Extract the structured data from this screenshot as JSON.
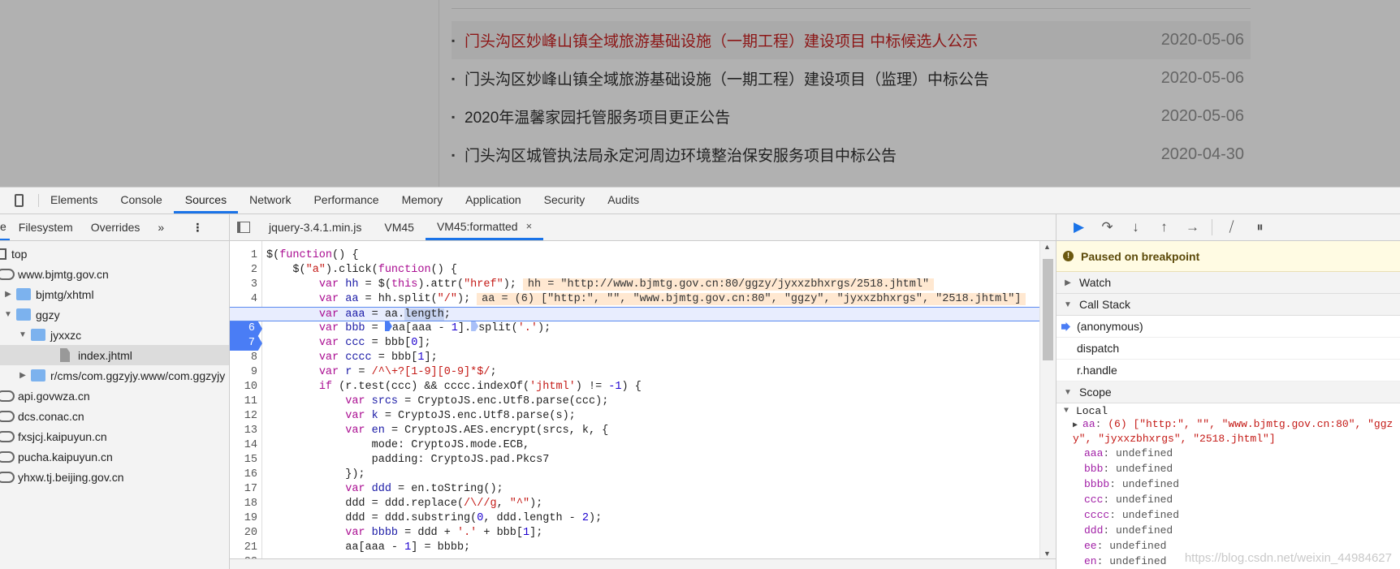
{
  "page": {
    "news": [
      {
        "title": "门头沟区妙峰山镇全域旅游基础设施（一期工程）建设项目 中标候选人公示",
        "date": "2020-05-06",
        "highlighted": true
      },
      {
        "title": "门头沟区妙峰山镇全域旅游基础设施（一期工程）建设项目（监理）中标公告",
        "date": "2020-05-06"
      },
      {
        "title": "2020年温馨家园托管服务项目更正公告",
        "date": "2020-05-06"
      },
      {
        "title": "门头沟区城管执法局永定河周边环境整治保安服务项目中标公告",
        "date": "2020-04-30"
      }
    ],
    "bullet": "▪"
  },
  "devtools": {
    "tabs": [
      "Elements",
      "Console",
      "Sources",
      "Network",
      "Performance",
      "Memory",
      "Application",
      "Security",
      "Audits"
    ],
    "active_tab": "Sources",
    "navigator": {
      "tabs": [
        "e",
        "Filesystem",
        "Overrides"
      ],
      "more": "»",
      "menu": "⋮",
      "tree": [
        {
          "label": "top",
          "type": "frame",
          "depth": 0
        },
        {
          "label": "www.bjmtg.gov.cn",
          "type": "cloud",
          "depth": 0
        },
        {
          "label": "bjmtg/xhtml",
          "type": "folder",
          "depth": 1,
          "state": "collapsed"
        },
        {
          "label": "ggzy",
          "type": "folder",
          "depth": 1,
          "state": "expanded"
        },
        {
          "label": "jyxxzc",
          "type": "folder",
          "depth": 2,
          "state": "expanded"
        },
        {
          "label": "index.jhtml",
          "type": "file",
          "depth": 3,
          "selected": true
        },
        {
          "label": "r/cms/com.ggzyjy.www/com.ggzyjy",
          "type": "folder",
          "depth": 2,
          "state": "collapsed"
        },
        {
          "label": "api.govwza.cn",
          "type": "cloud",
          "depth": 0
        },
        {
          "label": "dcs.conac.cn",
          "type": "cloud",
          "depth": 0
        },
        {
          "label": "fxsjcj.kaipuyun.cn",
          "type": "cloud",
          "depth": 0
        },
        {
          "label": "pucha.kaipuyun.cn",
          "type": "cloud",
          "depth": 0
        },
        {
          "label": "yhxw.tj.beijing.gov.cn",
          "type": "cloud",
          "depth": 0
        }
      ]
    },
    "editor": {
      "file_tabs": [
        {
          "label": "jquery-3.4.1.min.js"
        },
        {
          "label": "VM45"
        },
        {
          "label": "VM45:formatted",
          "active": true,
          "close": "×"
        }
      ],
      "current_line": 5,
      "breakpoints": [
        5,
        6,
        7
      ],
      "lines": [
        [
          [
            "",
            "$("
          ],
          [
            "kw",
            "function"
          ],
          [
            "",
            "() {"
          ]
        ],
        [
          [
            "",
            "    $("
          ],
          [
            "str",
            "\"a\""
          ],
          [
            "",
            ").click("
          ],
          [
            "kw",
            "function"
          ],
          [
            "",
            "() {"
          ]
        ],
        [
          [
            "",
            "        "
          ],
          [
            "kw",
            "var"
          ],
          [
            "vn",
            " hh"
          ],
          [
            "",
            " = $("
          ],
          [
            "kw",
            "this"
          ],
          [
            "",
            ").attr("
          ],
          [
            "str",
            "\"href\""
          ],
          [
            "",
            ");"
          ],
          [
            "tip",
            "hh = \"http://www.bjmtg.gov.cn:80/ggzy/jyxxzbhxrgs/2518.jhtml\""
          ]
        ],
        [
          [
            "",
            "        "
          ],
          [
            "kw",
            "var"
          ],
          [
            "vn",
            " aa"
          ],
          [
            "",
            " = hh.split("
          ],
          [
            "str",
            "\"/\""
          ],
          [
            "",
            ");"
          ],
          [
            "tip",
            "aa = (6) [\"http:\", \"\", \"www.bjmtg.gov.cn:80\", \"ggzy\", \"jyxxzbhxrgs\", \"2518.jhtml\"]"
          ]
        ],
        [
          [
            "",
            "        "
          ],
          [
            "kw",
            "var"
          ],
          [
            "vn",
            " aaa"
          ],
          [
            "",
            " = aa."
          ],
          [
            "sel",
            "length"
          ],
          [
            "",
            ";"
          ]
        ],
        [
          [
            "",
            "        "
          ],
          [
            "kw",
            "var"
          ],
          [
            "vn",
            " bbb"
          ],
          [
            "",
            " = "
          ],
          [
            "ibp",
            ""
          ],
          [
            "",
            "aa[aaa - "
          ],
          [
            "num",
            "1"
          ],
          [
            "",
            "]."
          ],
          [
            "ibp lt",
            ""
          ],
          [
            "",
            "split("
          ],
          [
            "str",
            "'.'"
          ],
          [
            "",
            ");"
          ]
        ],
        [
          [
            "",
            "        "
          ],
          [
            "kw",
            "var"
          ],
          [
            "vn",
            " ccc"
          ],
          [
            "",
            " = bbb["
          ],
          [
            "num",
            "0"
          ],
          [
            "",
            "];"
          ]
        ],
        [
          [
            "",
            "        "
          ],
          [
            "kw",
            "var"
          ],
          [
            "vn",
            " cccc"
          ],
          [
            "",
            " = bbb["
          ],
          [
            "num",
            "1"
          ],
          [
            "",
            "];"
          ]
        ],
        [
          [
            "",
            "        "
          ],
          [
            "kw",
            "var"
          ],
          [
            "vn",
            " r"
          ],
          [
            "",
            " = "
          ],
          [
            "str",
            "/^\\+?[1-9][0-9]*$/"
          ],
          [
            "",
            ";"
          ]
        ],
        [
          [
            "",
            "        "
          ],
          [
            "kw",
            "if"
          ],
          [
            "",
            " (r.test(ccc) && cccc.indexOf("
          ],
          [
            "str",
            "'jhtml'"
          ],
          [
            "",
            ") != "
          ],
          [
            "num",
            "-1"
          ],
          [
            "",
            ") {"
          ]
        ],
        [
          [
            "",
            "            "
          ],
          [
            "kw",
            "var"
          ],
          [
            "vn",
            " srcs"
          ],
          [
            "",
            " = CryptoJS.enc.Utf8.parse(ccc);"
          ]
        ],
        [
          [
            "",
            "            "
          ],
          [
            "kw",
            "var"
          ],
          [
            "vn",
            " k"
          ],
          [
            "",
            " = CryptoJS.enc.Utf8.parse(s);"
          ]
        ],
        [
          [
            "",
            "            "
          ],
          [
            "kw",
            "var"
          ],
          [
            "vn",
            " en"
          ],
          [
            "",
            " = CryptoJS.AES.encrypt(srcs, k, {"
          ]
        ],
        [
          [
            "",
            "                mode: CryptoJS.mode.ECB,"
          ]
        ],
        [
          [
            "",
            "                padding: CryptoJS.pad.Pkcs7"
          ]
        ],
        [
          [
            "",
            "            });"
          ]
        ],
        [
          [
            "",
            "            "
          ],
          [
            "kw",
            "var"
          ],
          [
            "vn",
            " ddd"
          ],
          [
            "",
            " = en.toString();"
          ]
        ],
        [
          [
            "",
            "            ddd = ddd.replace("
          ],
          [
            "str",
            "/\\//g"
          ],
          [
            "",
            ", "
          ],
          [
            "str",
            "\"^\""
          ],
          [
            "",
            ");"
          ]
        ],
        [
          [
            "",
            "            ddd = ddd.substring("
          ],
          [
            "num",
            "0"
          ],
          [
            "",
            ", ddd.length - "
          ],
          [
            "num",
            "2"
          ],
          [
            "",
            ");"
          ]
        ],
        [
          [
            "",
            "            "
          ],
          [
            "kw",
            "var"
          ],
          [
            "vn",
            " bbbb"
          ],
          [
            "",
            " = ddd + "
          ],
          [
            "str",
            "'.'"
          ],
          [
            "",
            " + bbb["
          ],
          [
            "num",
            "1"
          ],
          [
            "",
            "];"
          ]
        ],
        [
          [
            "",
            "            aa[aaa - "
          ],
          [
            "num",
            "1"
          ],
          [
            "",
            "] = bbbb;"
          ]
        ]
      ]
    },
    "debugger": {
      "paused_message": "Paused on breakpoint",
      "watch": "Watch",
      "call_stack": {
        "title": "Call Stack",
        "frames": [
          "(anonymous)",
          "dispatch",
          "r.handle"
        ]
      },
      "scope": {
        "title": "Scope",
        "local_label": "Local",
        "vars": [
          {
            "name": "aa",
            "value": "(6) [\"http:\", \"\", \"www.bjmtg.gov.cn:80\", \"ggzy\", \"jyxxzbhxrgs\", \"2518.jhtml\"]",
            "expandable": true
          },
          {
            "name": "aaa",
            "value": "undefined"
          },
          {
            "name": "bbb",
            "value": "undefined"
          },
          {
            "name": "bbbb",
            "value": "undefined"
          },
          {
            "name": "ccc",
            "value": "undefined"
          },
          {
            "name": "cccc",
            "value": "undefined"
          },
          {
            "name": "ddd",
            "value": "undefined"
          },
          {
            "name": "ee",
            "value": "undefined"
          },
          {
            "name": "en",
            "value": "undefined"
          }
        ]
      }
    },
    "watermark": "https://blog.csdn.net/weixin_44984627"
  },
  "colors": {
    "accent": "#1a73e8",
    "breakpoint": "#4a7df5",
    "paused_bg": "#fffbe3",
    "highlight_link": "#8c1616"
  }
}
